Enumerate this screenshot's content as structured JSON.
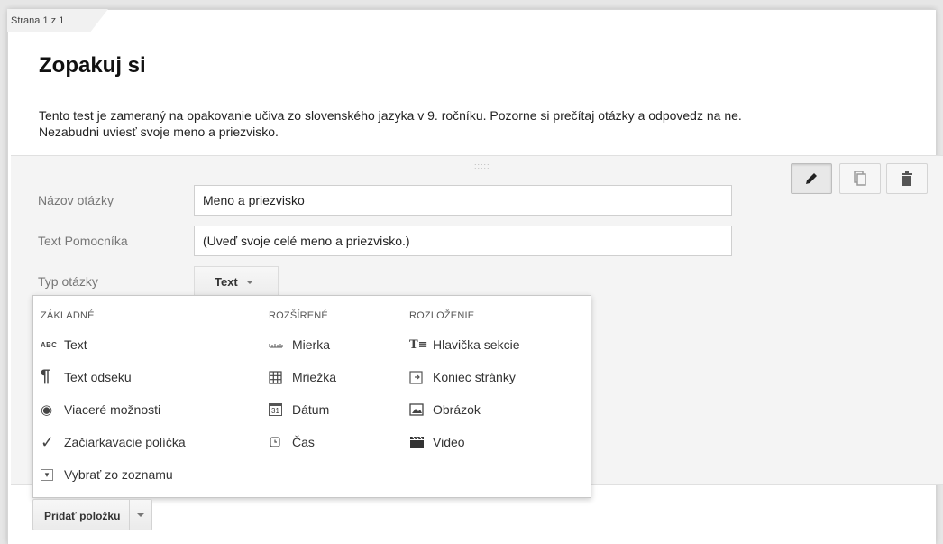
{
  "page_indicator": "Strana 1 z 1",
  "form": {
    "title": "Zopakuj si",
    "description_line1": "Tento test je zameraný na opakovanie učiva zo slovenského jazyka v 9. ročníku. Pozorne si prečítaj otázky a odpovedz na ne.",
    "description_line2": "Nezabudni uviesť svoje meno a priezvisko."
  },
  "question": {
    "drag_handle": ":::::",
    "title_label": "Názov otázky",
    "title_value": "Meno a priezvisko",
    "help_label": "Text Pomocníka",
    "help_value": "(Uveď svoje celé meno a priezvisko.)",
    "type_label": "Typ otázky",
    "type_value": "Text",
    "toolbar": {
      "edit": "pencil-icon",
      "duplicate": "duplicate-icon",
      "delete": "trash-icon"
    }
  },
  "type_menu": {
    "basic_header": "ZÁKLADNÉ",
    "advanced_header": "ROZŠÍRENÉ",
    "layout_header": "ROZLOŽENIE",
    "basic": [
      {
        "label": "Text",
        "icon": "abc-icon",
        "glyph": "ABC"
      },
      {
        "label": "Text odseku",
        "icon": "paragraph-icon",
        "glyph": "¶"
      },
      {
        "label": "Viaceré možnosti",
        "icon": "radio-icon",
        "glyph": "◉"
      },
      {
        "label": "Začiarkavacie políčka",
        "icon": "checkmark-icon",
        "glyph": "✓"
      },
      {
        "label": "Vybrať zo zoznamu",
        "icon": "dropdown-icon",
        "glyph": "▾"
      }
    ],
    "advanced": [
      {
        "label": "Mierka",
        "icon": "scale-icon"
      },
      {
        "label": "Mriežka",
        "icon": "grid-icon"
      },
      {
        "label": "Dátum",
        "icon": "calendar-icon",
        "glyph": "31"
      },
      {
        "label": "Čas",
        "icon": "clock-icon"
      }
    ],
    "layout": [
      {
        "label": "Hlavička sekcie",
        "icon": "section-header-icon",
        "glyph": "T≡"
      },
      {
        "label": "Koniec stránky",
        "icon": "page-break-icon"
      },
      {
        "label": "Obrázok",
        "icon": "image-icon"
      },
      {
        "label": "Video",
        "icon": "video-icon"
      }
    ]
  },
  "add_item_button": "Pridať položku",
  "colors": {
    "page_bg": "#ffffff",
    "question_bg": "#f4f4f4",
    "text": "#222222",
    "muted": "#777777"
  }
}
